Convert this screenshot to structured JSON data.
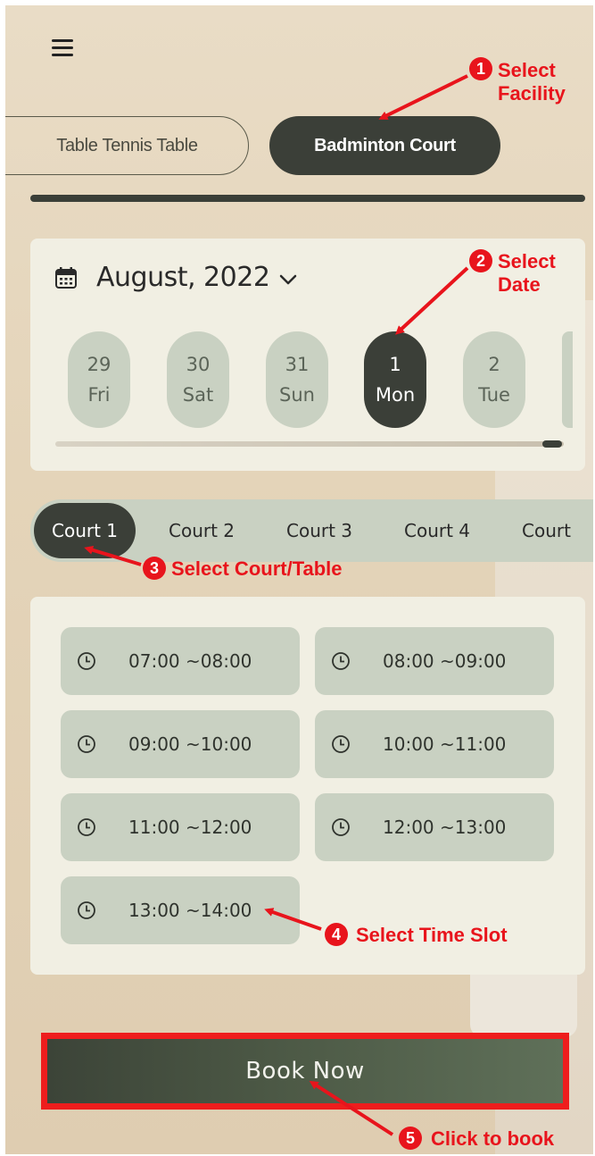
{
  "header": {
    "menu_icon": "hamburger-menu-icon"
  },
  "facilities": {
    "tabs": [
      {
        "label": "Table Tennis Table",
        "selected": false
      },
      {
        "label": "Badminton Court",
        "selected": true
      }
    ]
  },
  "date_picker": {
    "calendar_icon": "calendar-icon",
    "month": "August, 2022",
    "chevron_icon": "chevron-down-icon",
    "days": [
      {
        "num": "29",
        "dow": "Fri",
        "selected": false
      },
      {
        "num": "30",
        "dow": "Sat",
        "selected": false
      },
      {
        "num": "31",
        "dow": "Sun",
        "selected": false
      },
      {
        "num": "1",
        "dow": "Mon",
        "selected": true
      },
      {
        "num": "2",
        "dow": "Tue",
        "selected": false
      }
    ]
  },
  "courts": {
    "items": [
      "Court  1",
      "Court  2",
      "Court  3",
      "Court  4",
      "Court"
    ],
    "selected_index": 0
  },
  "time_slots": {
    "clock_icon": "clock-icon",
    "slots": [
      "07:00 ~08:00",
      "08:00 ~09:00",
      "09:00 ~10:00",
      "10:00 ~11:00",
      "11:00 ~12:00",
      "12:00 ~13:00",
      "13:00 ~14:00"
    ]
  },
  "book_button": {
    "label": "Book Now"
  },
  "annotations": {
    "color": "#e8141c",
    "steps": [
      {
        "num": "1",
        "line1": "Select",
        "line2": "Facility"
      },
      {
        "num": "2",
        "line1": "Select",
        "line2": "Date"
      },
      {
        "num": "3",
        "line1": "Select Court/Table",
        "line2": ""
      },
      {
        "num": "4",
        "line1": "Select Time Slot",
        "line2": ""
      },
      {
        "num": "5",
        "line1": "Click to book",
        "line2": ""
      }
    ]
  },
  "colors": {
    "dark_green": "#3b3f38",
    "pill_bg": "#c9d1c2",
    "card_bg": "#f1efe3",
    "annotation_red": "#e8141c"
  }
}
